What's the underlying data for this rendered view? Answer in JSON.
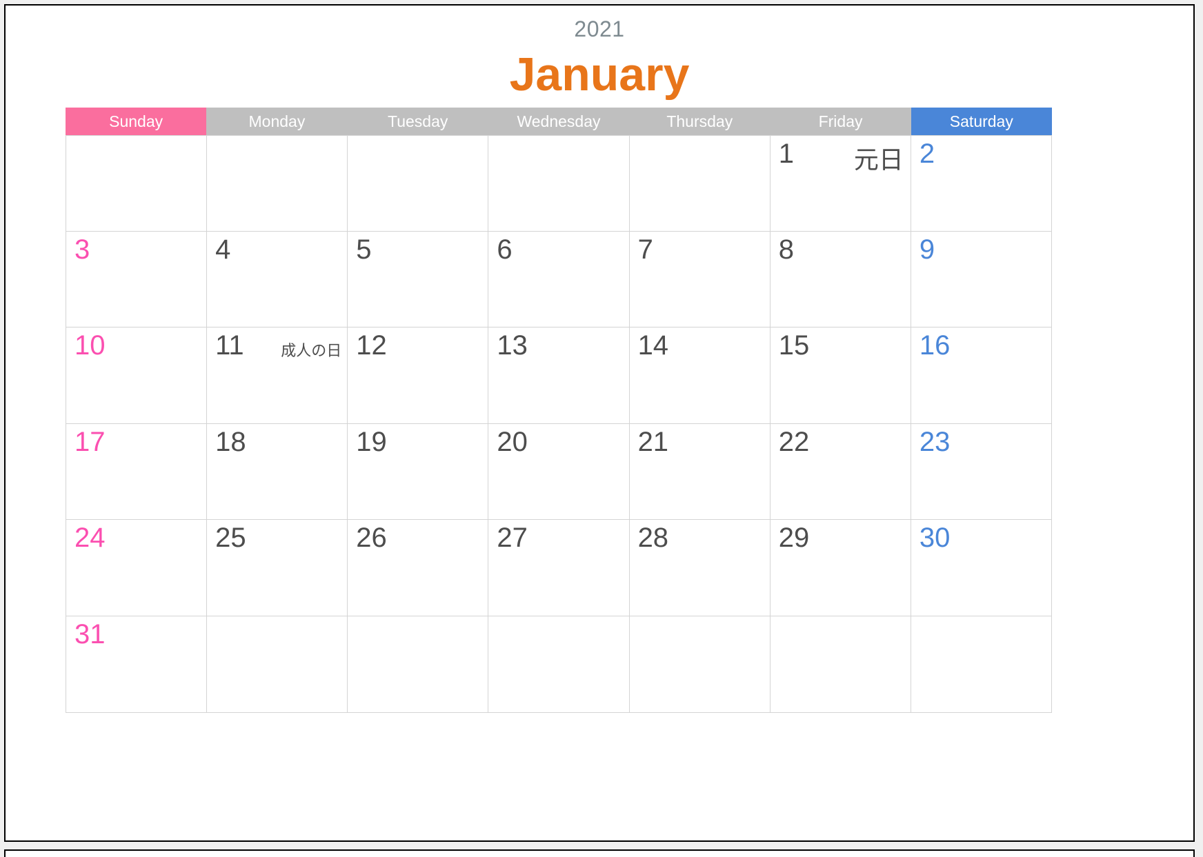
{
  "header": {
    "year": "2021",
    "month": "January",
    "year_color": "#7e8a90",
    "month_color": "#E8751A"
  },
  "colors": {
    "sunday_header_bg": "#FA6E9E",
    "weekday_header_bg": "#BFBFBF",
    "saturday_header_bg": "#4A86D8",
    "sunday_text": "#FB4FB0",
    "saturday_text": "#4A86D8",
    "weekday_text": "#4D4D4D",
    "grid_line": "#D4D4D4",
    "page_border": "#000000"
  },
  "day_headers": [
    {
      "label": "Sunday",
      "kind": "sun"
    },
    {
      "label": "Monday",
      "kind": "weekday"
    },
    {
      "label": "Tuesday",
      "kind": "weekday"
    },
    {
      "label": "Wednesday",
      "kind": "weekday"
    },
    {
      "label": "Thursday",
      "kind": "weekday"
    },
    {
      "label": "Friday",
      "kind": "weekday"
    },
    {
      "label": "Saturday",
      "kind": "sat"
    }
  ],
  "weeks": [
    [
      {
        "date": "",
        "holiday": ""
      },
      {
        "date": "",
        "holiday": ""
      },
      {
        "date": "",
        "holiday": ""
      },
      {
        "date": "",
        "holiday": ""
      },
      {
        "date": "",
        "holiday": ""
      },
      {
        "date": "1",
        "holiday": "元日"
      },
      {
        "date": "2",
        "holiday": ""
      }
    ],
    [
      {
        "date": "3",
        "holiday": ""
      },
      {
        "date": "4",
        "holiday": ""
      },
      {
        "date": "5",
        "holiday": ""
      },
      {
        "date": "6",
        "holiday": ""
      },
      {
        "date": "7",
        "holiday": ""
      },
      {
        "date": "8",
        "holiday": ""
      },
      {
        "date": "9",
        "holiday": ""
      }
    ],
    [
      {
        "date": "10",
        "holiday": ""
      },
      {
        "date": "11",
        "holiday": "成人の日"
      },
      {
        "date": "12",
        "holiday": ""
      },
      {
        "date": "13",
        "holiday": ""
      },
      {
        "date": "14",
        "holiday": ""
      },
      {
        "date": "15",
        "holiday": ""
      },
      {
        "date": "16",
        "holiday": ""
      }
    ],
    [
      {
        "date": "17",
        "holiday": ""
      },
      {
        "date": "18",
        "holiday": ""
      },
      {
        "date": "19",
        "holiday": ""
      },
      {
        "date": "20",
        "holiday": ""
      },
      {
        "date": "21",
        "holiday": ""
      },
      {
        "date": "22",
        "holiday": ""
      },
      {
        "date": "23",
        "holiday": ""
      }
    ],
    [
      {
        "date": "24",
        "holiday": ""
      },
      {
        "date": "25",
        "holiday": ""
      },
      {
        "date": "26",
        "holiday": ""
      },
      {
        "date": "27",
        "holiday": ""
      },
      {
        "date": "28",
        "holiday": ""
      },
      {
        "date": "29",
        "holiday": ""
      },
      {
        "date": "30",
        "holiday": ""
      }
    ],
    [
      {
        "date": "31",
        "holiday": ""
      },
      {
        "date": "",
        "holiday": ""
      },
      {
        "date": "",
        "holiday": ""
      },
      {
        "date": "",
        "holiday": ""
      },
      {
        "date": "",
        "holiday": ""
      },
      {
        "date": "",
        "holiday": ""
      },
      {
        "date": "",
        "holiday": ""
      }
    ]
  ]
}
